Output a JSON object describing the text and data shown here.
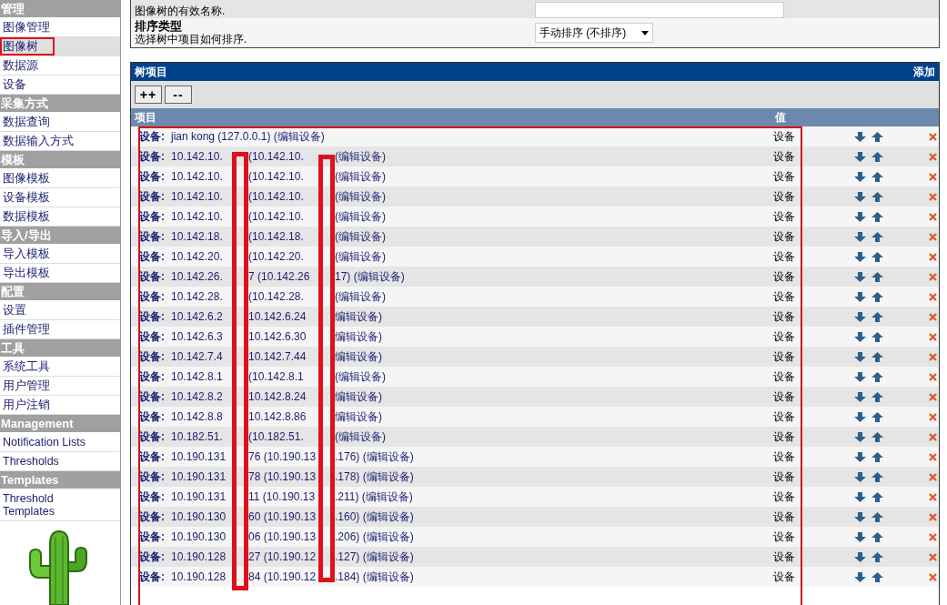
{
  "sidebar": {
    "sections": [
      {
        "heading": "管理",
        "items": [
          {
            "label": "图像管理",
            "selected": false
          },
          {
            "label": "图像树",
            "selected": true
          },
          {
            "label": "数据源",
            "selected": false
          },
          {
            "label": "设备",
            "selected": false
          }
        ]
      },
      {
        "heading": "采集方式",
        "items": [
          {
            "label": "数据查询",
            "selected": false
          },
          {
            "label": "数据输入方式",
            "selected": false
          }
        ]
      },
      {
        "heading": "模板",
        "items": [
          {
            "label": "图像模板",
            "selected": false
          },
          {
            "label": "设备模板",
            "selected": false
          },
          {
            "label": "数据模板",
            "selected": false
          }
        ]
      },
      {
        "heading": "导入/导出",
        "items": [
          {
            "label": "导入模板",
            "selected": false
          },
          {
            "label": "导出模板",
            "selected": false
          }
        ]
      },
      {
        "heading": "配置",
        "items": [
          {
            "label": "设置",
            "selected": false
          },
          {
            "label": "插件管理",
            "selected": false
          }
        ]
      },
      {
        "heading": "工具",
        "items": [
          {
            "label": "系统工具",
            "selected": false
          },
          {
            "label": "用户管理",
            "selected": false
          },
          {
            "label": "用户注销",
            "selected": false
          }
        ]
      },
      {
        "heading": "Management",
        "items": [
          {
            "label": "Notification Lists",
            "selected": false
          },
          {
            "label": "Thresholds",
            "selected": false
          }
        ]
      },
      {
        "heading": "Templates",
        "items": [
          {
            "label": "Threshold Templates",
            "selected": false
          }
        ]
      }
    ]
  },
  "form": {
    "rows": [
      {
        "description": "图像树的有效名称.",
        "control": {
          "kind": "input"
        }
      },
      {
        "title": "排序类型",
        "description": "选择树中项目如何排序.",
        "control": {
          "kind": "select",
          "value": "手动排序 (不排序)"
        }
      }
    ]
  },
  "tree_items": {
    "title": "树项目",
    "add_link": "添加",
    "buttons": [
      "++",
      "--"
    ],
    "columns": [
      "项目",
      "值"
    ],
    "rows": [
      {
        "prefix": "设备:",
        "parts": [
          "jian kong (127.0.0.1) (编辑设备)"
        ],
        "value": "设备"
      },
      {
        "prefix": "设备:",
        "parts": [
          "10.142.10.",
          "(10.142.10.",
          "(编辑设备)"
        ],
        "value": "设备"
      },
      {
        "prefix": "设备:",
        "parts": [
          "10.142.10.",
          "(10.142.10.",
          "(编辑设备)"
        ],
        "value": "设备"
      },
      {
        "prefix": "设备:",
        "parts": [
          "10.142.10.",
          "(10.142.10.",
          "(编辑设备)"
        ],
        "value": "设备"
      },
      {
        "prefix": "设备:",
        "parts": [
          "10.142.10.",
          "(10.142.10.",
          "(编辑设备)"
        ],
        "value": "设备"
      },
      {
        "prefix": "设备:",
        "parts": [
          "10.142.18.",
          "(10.142.18.",
          "(编辑设备)"
        ],
        "value": "设备"
      },
      {
        "prefix": "设备:",
        "parts": [
          "10.142.20.",
          "(10.142.20.",
          "(编辑设备)"
        ],
        "value": "设备"
      },
      {
        "prefix": "设备:",
        "parts": [
          "10.142.26.",
          "7 (10.142.26",
          "17) (编辑设备)"
        ],
        "value": "设备"
      },
      {
        "prefix": "设备:",
        "parts": [
          "10.142.28.",
          "(10.142.28.",
          "(编辑设备)"
        ],
        "value": "设备"
      },
      {
        "prefix": "设备:",
        "parts": [
          "10.142.6.2",
          "10.142.6.24",
          "编辑设备)"
        ],
        "value": "设备"
      },
      {
        "prefix": "设备:",
        "parts": [
          "10.142.6.3",
          "10.142.6.30",
          "编辑设备)"
        ],
        "value": "设备"
      },
      {
        "prefix": "设备:",
        "parts": [
          "10.142.7.4",
          "10.142.7.44",
          "编辑设备)"
        ],
        "value": "设备"
      },
      {
        "prefix": "设备:",
        "parts": [
          "10.142.8.1",
          "(10.142.8.1",
          "(编辑设备)"
        ],
        "value": "设备"
      },
      {
        "prefix": "设备:",
        "parts": [
          "10.142.8.2",
          "10.142.8.24",
          "编辑设备)"
        ],
        "value": "设备"
      },
      {
        "prefix": "设备:",
        "parts": [
          "10.142.8.8",
          "10.142.8.86",
          "编辑设备)"
        ],
        "value": "设备"
      },
      {
        "prefix": "设备:",
        "parts": [
          "10.182.51.",
          "(10.182.51.",
          "(编辑设备)"
        ],
        "value": "设备"
      },
      {
        "prefix": "设备:",
        "parts": [
          "10.190.131",
          "76 (10.190.13",
          ".176) (编辑设备)"
        ],
        "value": "设备"
      },
      {
        "prefix": "设备:",
        "parts": [
          "10.190.131",
          "78 (10.190.13",
          ".178) (编辑设备)"
        ],
        "value": "设备"
      },
      {
        "prefix": "设备:",
        "parts": [
          "10.190.131",
          "11 (10.190.13",
          ".211) (编辑设备)"
        ],
        "value": "设备"
      },
      {
        "prefix": "设备:",
        "parts": [
          "10.190.130",
          "60 (10.190.13",
          ".160) (编辑设备)"
        ],
        "value": "设备"
      },
      {
        "prefix": "设备:",
        "parts": [
          "10.190.130",
          "06 (10.190.13",
          ".206) (编辑设备)"
        ],
        "value": "设备"
      },
      {
        "prefix": "设备:",
        "parts": [
          "10.190.128",
          "27 (10.190.12",
          ".127) (编辑设备)"
        ],
        "value": "设备"
      },
      {
        "prefix": "设备:",
        "parts": [
          "10.190.128",
          "84 (10.190.12",
          ".184) (编辑设备)"
        ],
        "value": "设备"
      }
    ]
  }
}
